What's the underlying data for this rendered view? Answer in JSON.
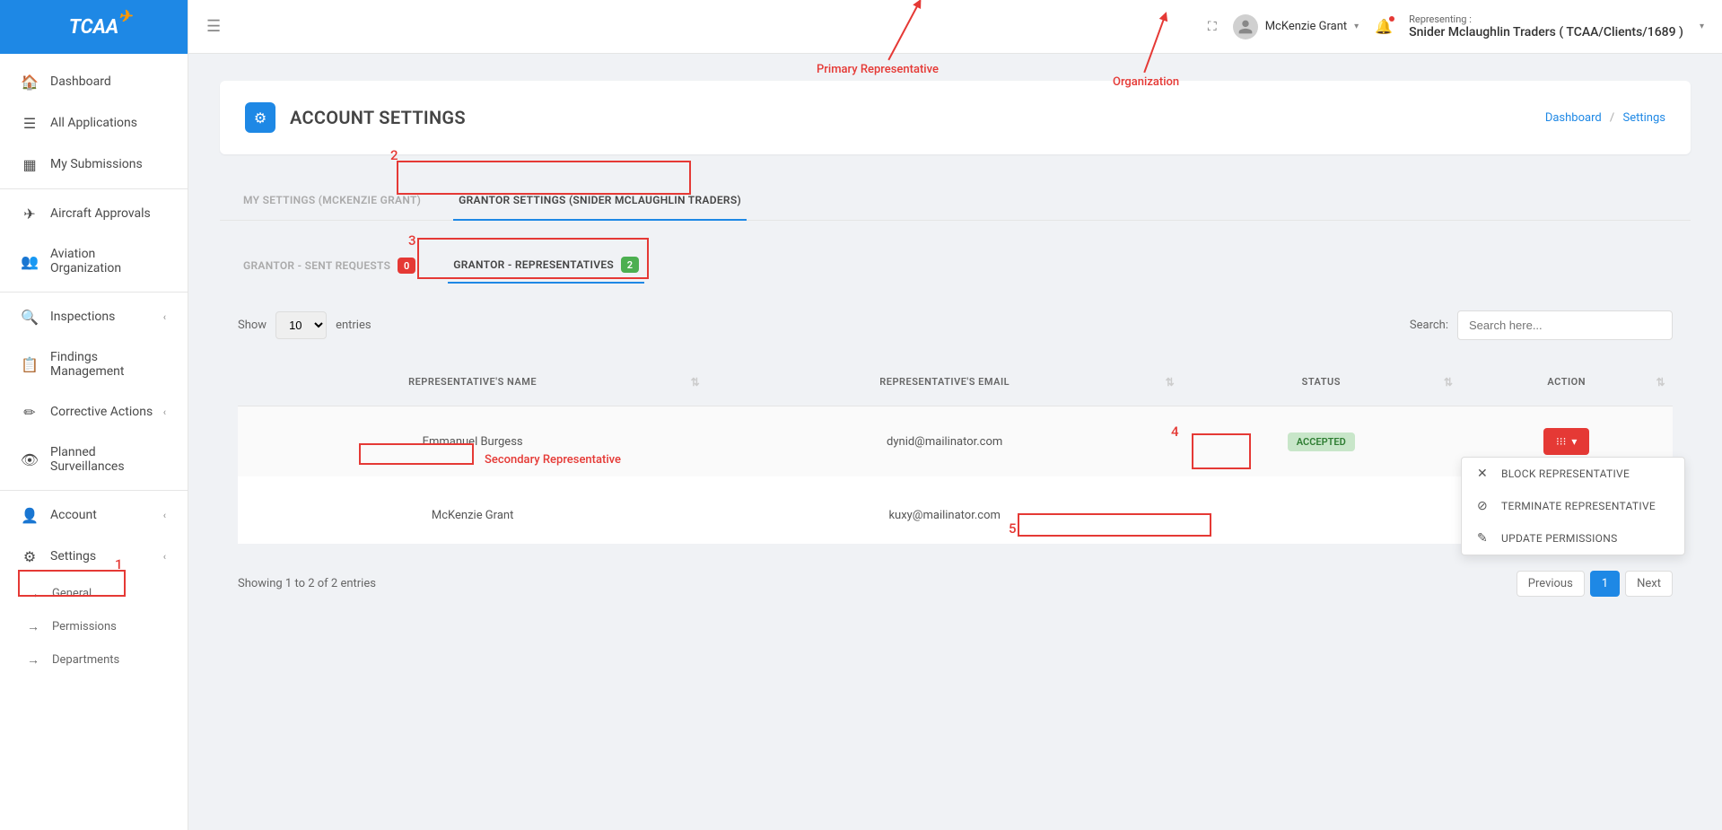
{
  "logo": "TCAA",
  "sidebar": {
    "items": [
      {
        "icon": "🏠",
        "label": "Dashboard"
      },
      {
        "icon": "☰",
        "label": "All Applications"
      },
      {
        "icon": "▦",
        "label": "My Submissions"
      }
    ],
    "group2": [
      {
        "icon": "✈",
        "label": "Aircraft Approvals"
      },
      {
        "icon": "👥",
        "label": "Aviation Organization"
      }
    ],
    "group3": [
      {
        "icon": "🔍",
        "label": "Inspections",
        "chevron": true
      },
      {
        "icon": "📋",
        "label": "Findings Management"
      },
      {
        "icon": "✏",
        "label": "Corrective Actions",
        "chevron": true
      },
      {
        "icon": "👁",
        "label": "Planned Surveillances"
      }
    ],
    "group4": [
      {
        "icon": "👤",
        "label": "Account",
        "chevron": true
      },
      {
        "icon": "⚙",
        "label": "Settings",
        "chevron": true
      }
    ],
    "subs": [
      {
        "label": "General"
      },
      {
        "label": "Permissions"
      },
      {
        "label": "Departments"
      }
    ]
  },
  "topbar": {
    "user_name": "McKenzie Grant",
    "representing_label": "Representing :",
    "representing_value": "Snider Mclaughlin Traders ( TCAA/Clients/1689 )"
  },
  "page": {
    "title": "ACCOUNT SETTINGS",
    "breadcrumb": {
      "a": "Dashboard",
      "b": "Settings"
    }
  },
  "tabs_outer": [
    {
      "label": "MY SETTINGS (MCKENZIE GRANT)"
    },
    {
      "label": "GRANTOR SETTINGS (SNIDER MCLAUGHLIN TRADERS)"
    }
  ],
  "tabs_inner": [
    {
      "label": "GRANTOR - SENT REQUESTS",
      "badge": "0"
    },
    {
      "label": "GRANTOR - REPRESENTATIVES",
      "badge": "2"
    }
  ],
  "table_controls": {
    "show": "Show",
    "entries": "entries",
    "entries_value": "10",
    "search": "Search:",
    "search_placeholder": "Search here..."
  },
  "table": {
    "headers": [
      "REPRESENTATIVE'S NAME",
      "REPRESENTATIVE'S EMAIL",
      "STATUS",
      "ACTION"
    ],
    "rows": [
      {
        "name": "Emmanuel Burgess",
        "email": "dynid@mailinator.com",
        "status": "ACCEPTED"
      },
      {
        "name": "McKenzie Grant",
        "email": "kuxy@mailinator.com",
        "status": ""
      }
    ]
  },
  "dropdown": {
    "items": [
      {
        "icon": "✕",
        "label": "BLOCK REPRESENTATIVE"
      },
      {
        "icon": "⊘",
        "label": "TERMINATE REPRESENTATIVE"
      },
      {
        "icon": "✎",
        "label": "UPDATE PERMISSIONS"
      }
    ]
  },
  "footer": {
    "showing": "Showing 1 to 2 of 2 entries",
    "prev": "Previous",
    "page": "1",
    "next": "Next"
  },
  "annotations": {
    "primary_rep": "Primary Representative",
    "organization": "Organization",
    "secondary_rep": "Secondary Representative",
    "n1": "1",
    "n2": "2",
    "n3": "3",
    "n4": "4",
    "n5": "5"
  }
}
